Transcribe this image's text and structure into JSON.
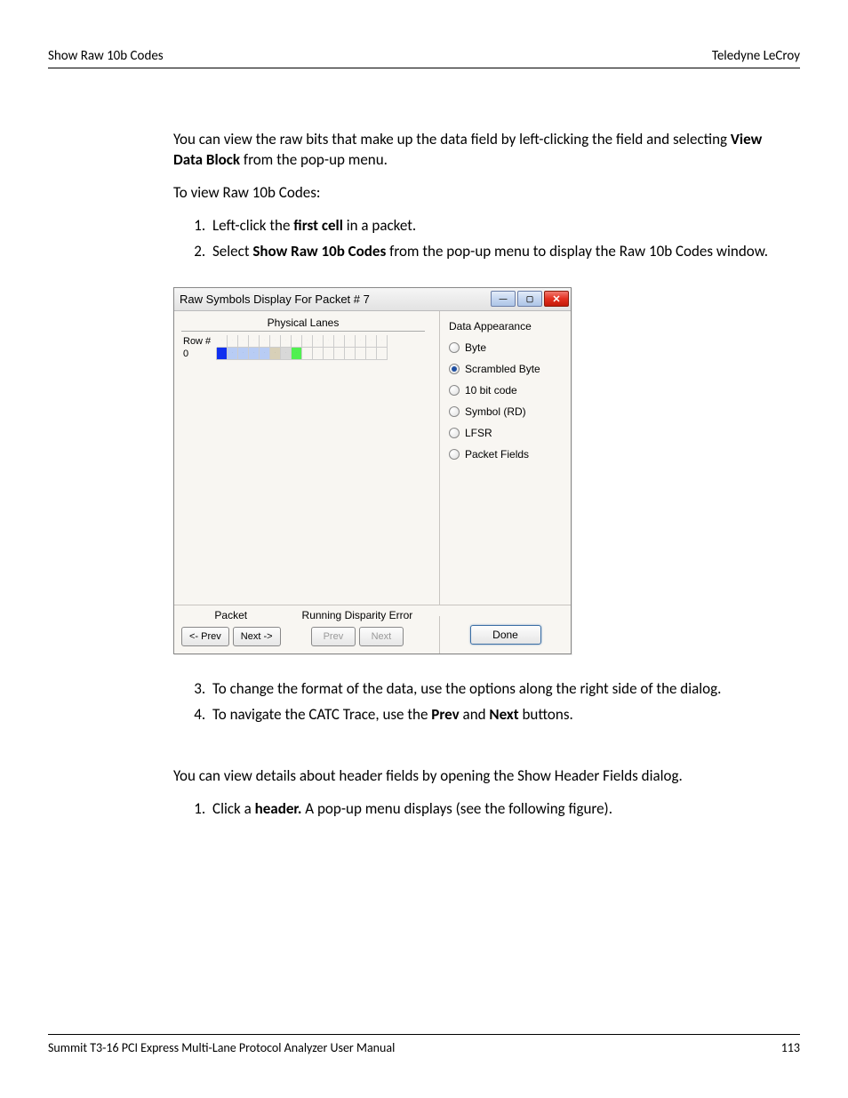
{
  "header": {
    "left": "Show Raw 10b Codes",
    "right": "Teledyne LeCroy"
  },
  "body": {
    "intro_1a": "You can view the raw bits that make up the data field by left-clicking the field and selecting ",
    "intro_1b_bold": "View Data Block",
    "intro_1c": " from the pop-up menu.",
    "intro_2": "To view Raw 10b Codes:",
    "step1_a": "Left-click the ",
    "step1_b_bold": "first cell",
    "step1_c": " in a packet.",
    "step2_a": "Select ",
    "step2_b_bold": "Show Raw 10b Codes",
    "step2_c": " from the pop-up menu to display the Raw 10b Codes window.",
    "step3": "To change the format of the data, use the options along the right side of the dialog.",
    "step4_a": "To navigate the CATC Trace, use the ",
    "step4_b_bold": "Prev",
    "step4_c": " and ",
    "step4_d_bold": "Next",
    "step4_e": " buttons.",
    "outro": "You can view details about header fields by opening the Show Header Fields dialog.",
    "outro_step1_a": "Click a ",
    "outro_step1_b_bold": "header.",
    "outro_step1_c": " A pop-up menu displays (see the following figure)."
  },
  "dialog": {
    "title": "Raw Symbols Display For Packet # 7",
    "phys_label": "Physical Lanes",
    "row_header": "Row #",
    "row0_label": "0",
    "appearance_label": "Data Appearance",
    "options": {
      "byte": "Byte",
      "scrambled": "Scrambled Byte",
      "tenbit": "10 bit code",
      "symbol": "Symbol (RD)",
      "lfsr": "LFSR",
      "pfields": "Packet Fields"
    },
    "selected_option": "scrambled",
    "packet_label": "Packet",
    "rde_label": "Running Disparity Error",
    "prev_btn": "<- Prev",
    "next_btn": "Next ->",
    "rde_prev": "Prev",
    "rde_next": "Next",
    "done": "Done"
  },
  "footer": {
    "left": "Summit T3-16 PCI Express Multi-Lane Protocol Analyzer User Manual",
    "right": "113"
  }
}
